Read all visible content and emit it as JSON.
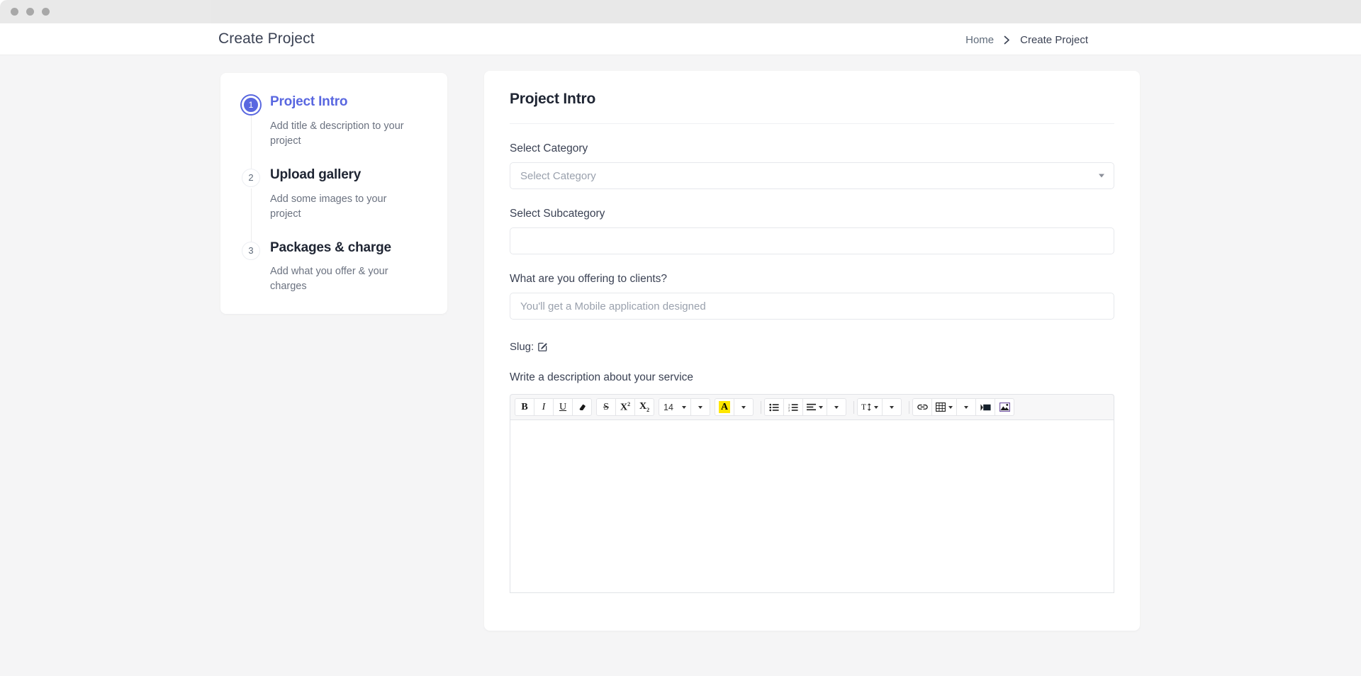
{
  "window": {
    "traffic_lights": [
      "close",
      "minimize",
      "maximize"
    ]
  },
  "header": {
    "title": "Create Project",
    "breadcrumb": {
      "home_label": "Home",
      "separator": "›",
      "current_label": "Create Project"
    }
  },
  "stepper": {
    "steps": [
      {
        "number": "1",
        "title": "Project Intro",
        "description": "Add title & description to your project",
        "active": true
      },
      {
        "number": "2",
        "title": "Upload gallery",
        "description": "Add some images to your project",
        "active": false
      },
      {
        "number": "3",
        "title": "Packages & charge",
        "description": "Add what you offer & your charges",
        "active": false
      }
    ]
  },
  "form": {
    "title": "Project Intro",
    "category": {
      "label": "Select Category",
      "value": "",
      "placeholder": "Select Category"
    },
    "subcategory": {
      "label": "Select Subcategory",
      "value": "",
      "placeholder": ""
    },
    "offering": {
      "label": "What are you offering to clients?",
      "value": "",
      "placeholder": "You'll get a Mobile application designed"
    },
    "slug": {
      "label": "Slug:",
      "value": "",
      "edit_icon": "edit-square-icon"
    },
    "description": {
      "label": "Write a description about your service",
      "content": ""
    }
  },
  "editor_toolbar": {
    "groups": [
      {
        "name": "format-basic",
        "buttons": [
          {
            "name": "bold-button",
            "label": "B",
            "icon": "bold-icon"
          },
          {
            "name": "italic-button",
            "label": "I",
            "icon": "italic-icon"
          },
          {
            "name": "underline-button",
            "label": "U",
            "icon": "underline-icon"
          },
          {
            "name": "clear-format-button",
            "label": "",
            "icon": "eraser-icon"
          }
        ]
      },
      {
        "name": "format-extra",
        "buttons": [
          {
            "name": "strikethrough-button",
            "label": "S",
            "icon": "strikethrough-icon"
          },
          {
            "name": "superscript-button",
            "label": "X2",
            "icon": "superscript-icon"
          },
          {
            "name": "subscript-button",
            "label": "X2",
            "icon": "subscript-icon"
          }
        ]
      },
      {
        "name": "font-size",
        "buttons": [
          {
            "name": "font-size-select",
            "label": "14",
            "icon": "chevron-down-icon"
          }
        ]
      },
      {
        "name": "text-color",
        "buttons": [
          {
            "name": "highlight-color-button",
            "label": "A",
            "icon": "highlight-icon"
          },
          {
            "name": "color-dropdown-button",
            "label": "",
            "icon": "chevron-down-icon"
          }
        ]
      },
      {
        "name": "lists",
        "buttons": [
          {
            "name": "bullet-list-button",
            "label": "",
            "icon": "bullet-list-icon"
          },
          {
            "name": "numbered-list-button",
            "label": "",
            "icon": "numbered-list-icon"
          },
          {
            "name": "align-button",
            "label": "",
            "icon": "align-left-icon"
          }
        ]
      },
      {
        "name": "line-height",
        "buttons": [
          {
            "name": "line-height-button",
            "label": "",
            "icon": "line-height-icon"
          }
        ]
      },
      {
        "name": "insert",
        "buttons": [
          {
            "name": "link-button",
            "label": "",
            "icon": "link-icon"
          },
          {
            "name": "table-button",
            "label": "",
            "icon": "table-icon"
          },
          {
            "name": "video-button",
            "label": "",
            "icon": "video-icon"
          },
          {
            "name": "image-button",
            "label": "",
            "icon": "image-icon"
          }
        ]
      }
    ],
    "font_size_value": "14"
  },
  "colors": {
    "accent": "#5967e0",
    "page_bg": "#f5f5f6",
    "card_bg": "#ffffff",
    "text_dark": "#1f2533",
    "text_muted": "#6b7280",
    "highlight": "#ffe600",
    "border": "#e6e8ec"
  }
}
